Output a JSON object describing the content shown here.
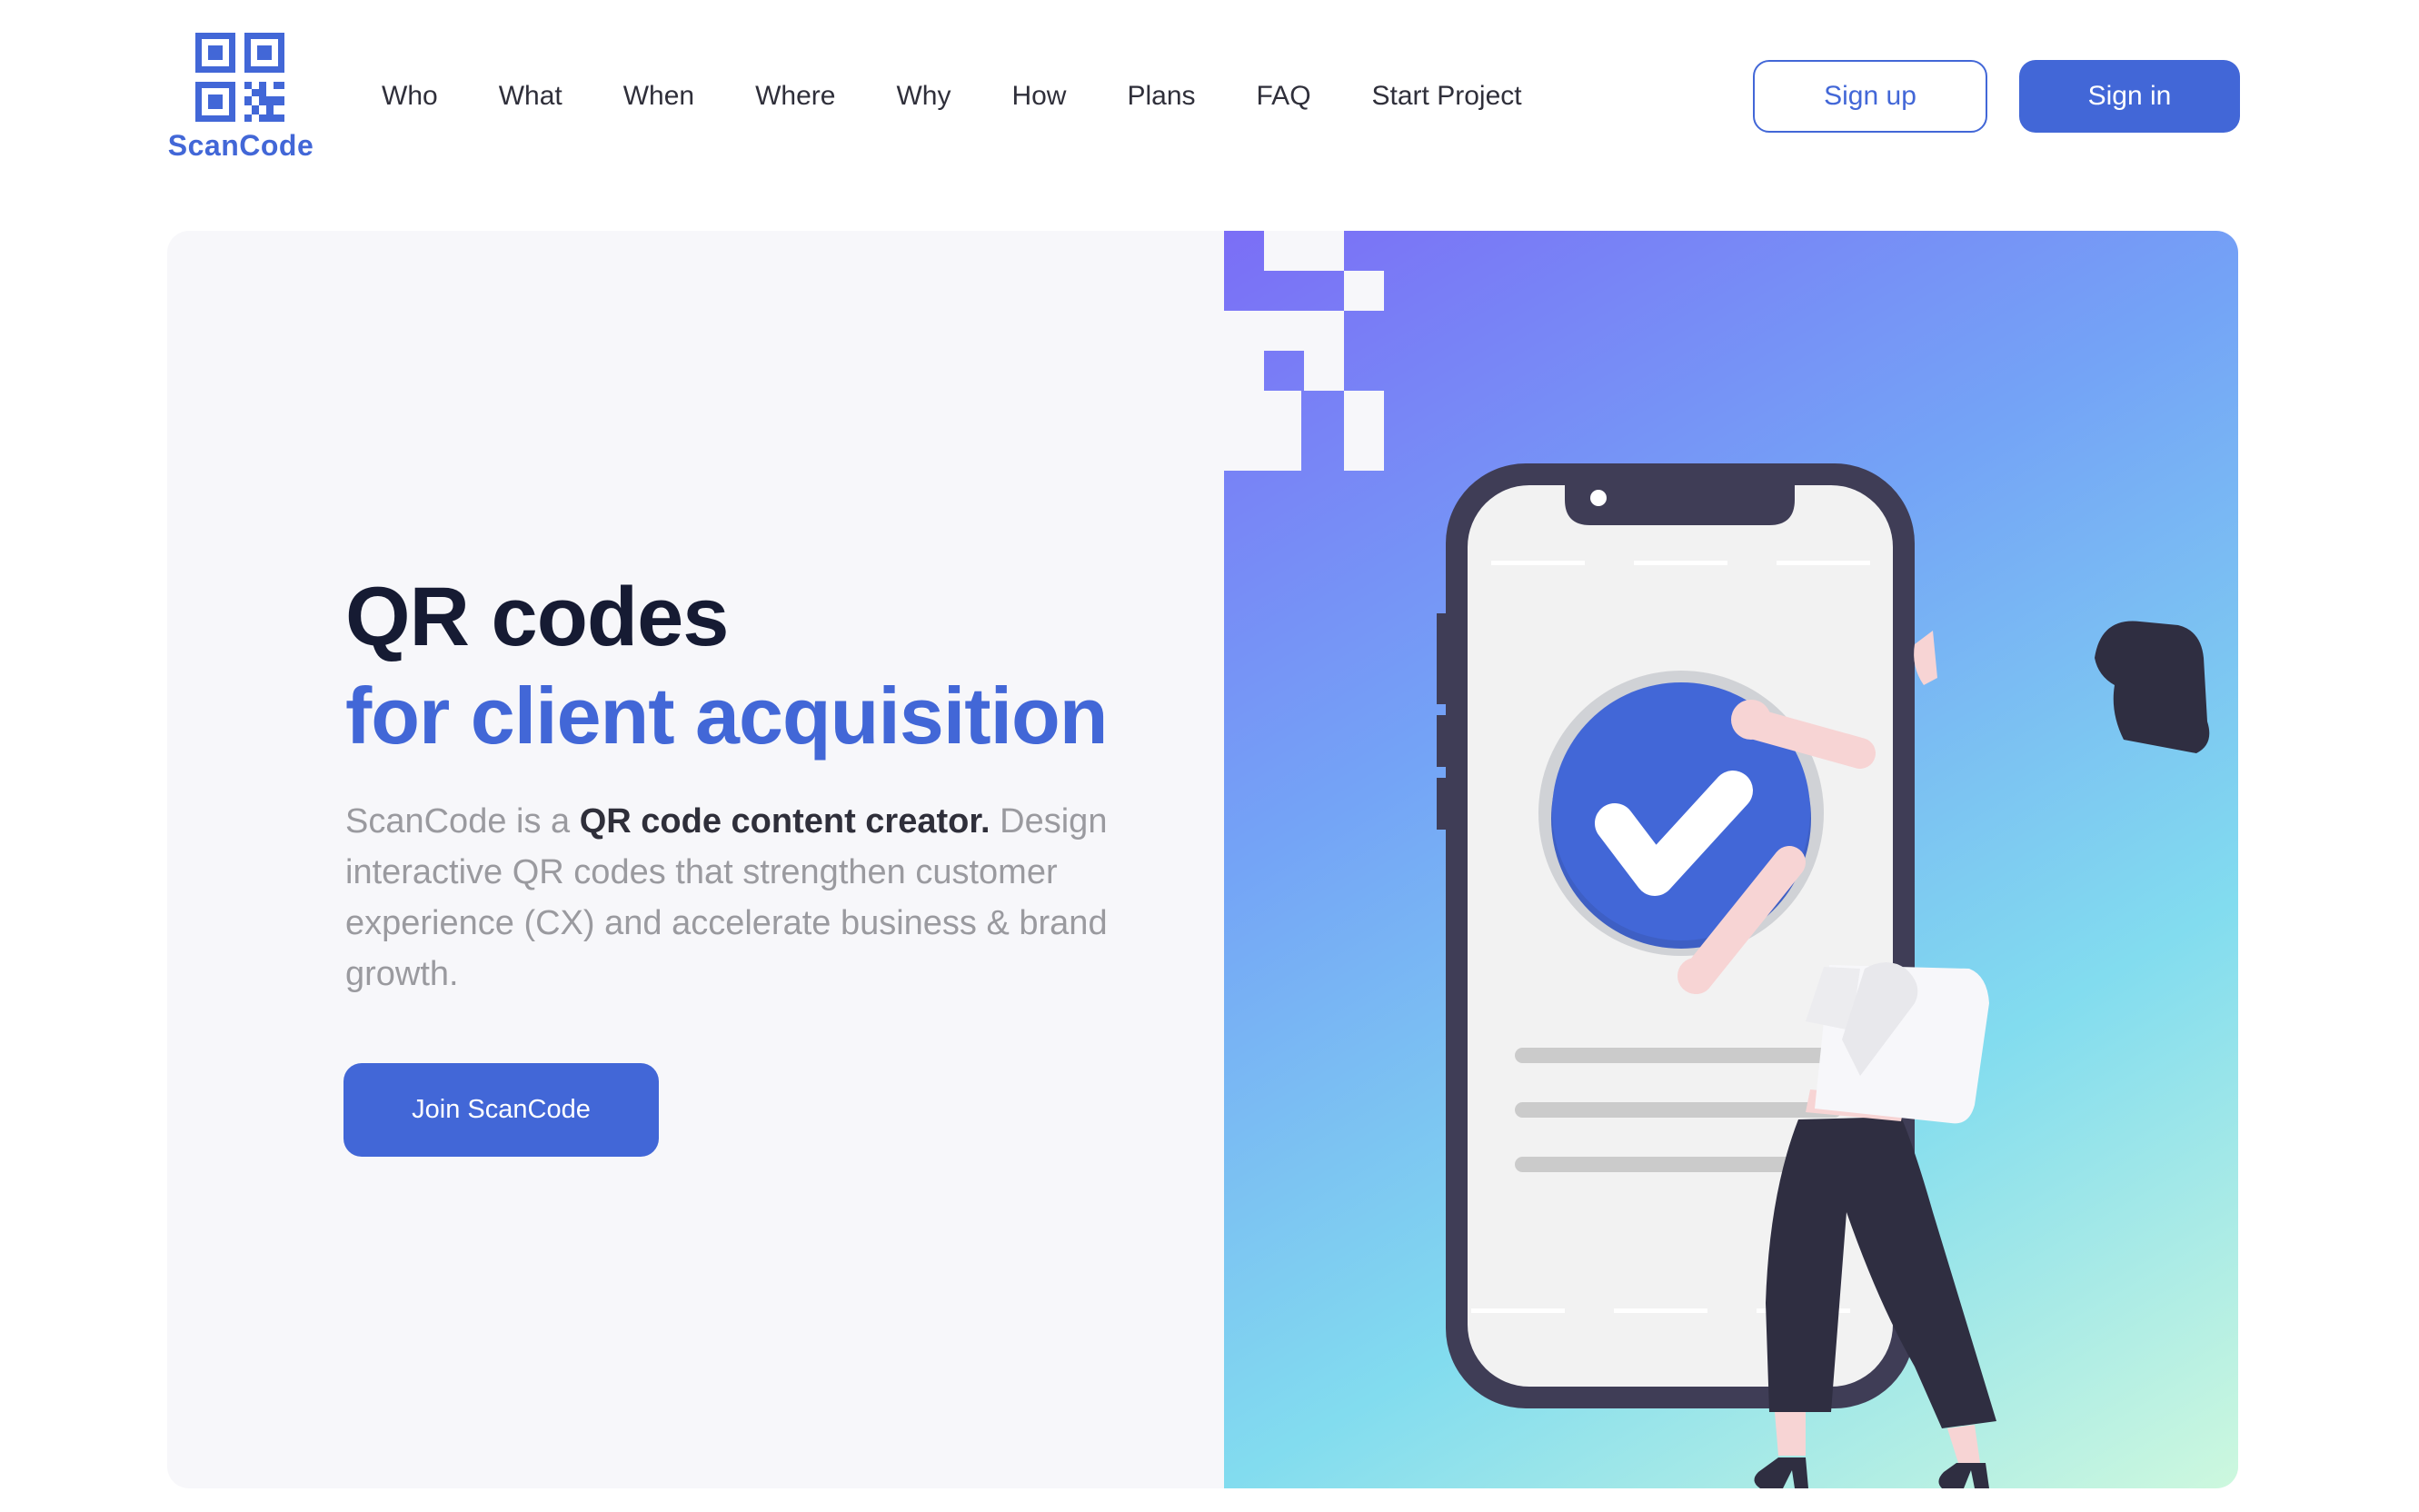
{
  "header": {
    "logo": {
      "icon": "qr-code-icon",
      "brand": "ScanCode"
    },
    "nav": [
      {
        "label": "Who"
      },
      {
        "label": "What"
      },
      {
        "label": "When"
      },
      {
        "label": "Where"
      },
      {
        "label": "Why"
      },
      {
        "label": "How"
      },
      {
        "label": "Plans"
      },
      {
        "label": "FAQ"
      },
      {
        "label": "Start Project"
      }
    ],
    "sign_up_label": "Sign up",
    "sign_in_label": "Sign in"
  },
  "hero": {
    "title_line1": "QR codes",
    "title_line2": "for client acquisition",
    "description": {
      "prefix": "ScanCode is a ",
      "bold": "QR code content creator.",
      "suffix": " Design interactive QR codes that strengthen customer experience (CX) and accelerate business & brand growth."
    },
    "cta_label": "Join ScanCode",
    "illustration": {
      "subject": "woman-holding-checkmark-badge-beside-phone",
      "icons": [
        "phone-icon",
        "checkmark-badge-icon",
        "qr-pixel-pattern"
      ]
    }
  },
  "colors": {
    "brand": "#4267d7",
    "heading_dark": "#161b33",
    "body_text": "#9a9a9f",
    "panel_bg": "#f7f7fa",
    "gradient": [
      "#7b6ef6",
      "#74a4f6",
      "#82dcef",
      "#cdf8de"
    ]
  }
}
